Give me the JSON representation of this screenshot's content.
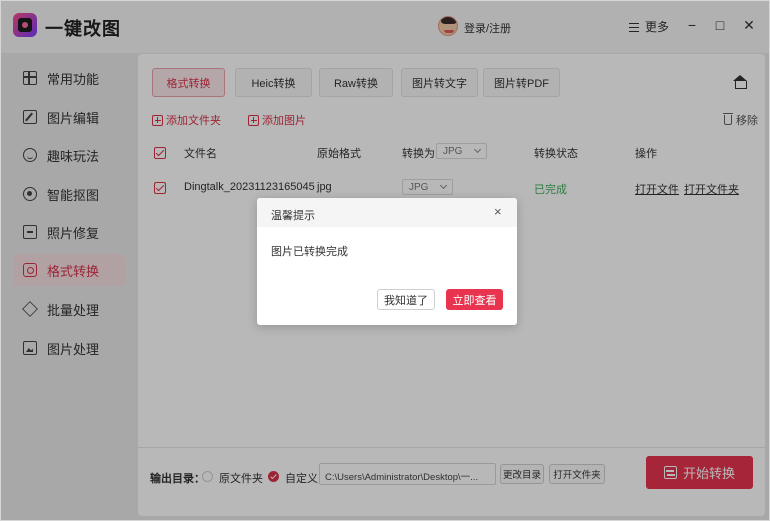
{
  "app": {
    "title": "一键改图",
    "login_label": "登录/注册",
    "more_label": "更多",
    "minimize_glyph": "−",
    "maximize_glyph": "□",
    "close_glyph": "✕"
  },
  "sidebar": {
    "items": [
      {
        "label": "常用功能",
        "icon": "grid-icon"
      },
      {
        "label": "图片编辑",
        "icon": "edit-icon"
      },
      {
        "label": "趣味玩法",
        "icon": "fun-icon"
      },
      {
        "label": "智能抠图",
        "icon": "target-icon"
      },
      {
        "label": "照片修复",
        "icon": "repair-icon"
      },
      {
        "label": "格式转换",
        "icon": "format-icon",
        "active": true
      },
      {
        "label": "批量处理",
        "icon": "layers-icon"
      },
      {
        "label": "图片处理",
        "icon": "image-icon"
      }
    ]
  },
  "tabs": [
    {
      "label": "格式转换",
      "active": true
    },
    {
      "label": "Heic转换"
    },
    {
      "label": "Raw转换"
    },
    {
      "label": "图片转文字"
    },
    {
      "label": "图片转PDF"
    }
  ],
  "toolbar": {
    "add_folder": "添加文件夹",
    "add_image": "添加图片",
    "remove": "移除"
  },
  "table": {
    "headers": {
      "filename": "文件名",
      "original_format": "原始格式",
      "convert_to": "转换为",
      "convert_to_value": "JPG",
      "status": "转换状态",
      "actions": "操作"
    },
    "rows": [
      {
        "filename": "Dingtalk_20231123165045",
        "original_format": "jpg",
        "target": "JPG",
        "status": "已完成",
        "open_file": "打开文件",
        "open_folder": "打开文件夹"
      }
    ]
  },
  "output": {
    "label": "输出目录：",
    "option_original": "原文件夹",
    "option_custom": "自定义",
    "path": "C:\\Users\\Administrator\\Desktop\\一...",
    "change_dir": "更改目录",
    "open_folder": "打开文件夹",
    "start": "开始转换"
  },
  "dialog": {
    "title": "温馨提示",
    "close_glyph": "×",
    "message": "图片已转换完成",
    "ok": "我知道了",
    "view": "立即查看"
  },
  "colors": {
    "accent": "#e8344f",
    "success": "#3fae59"
  }
}
